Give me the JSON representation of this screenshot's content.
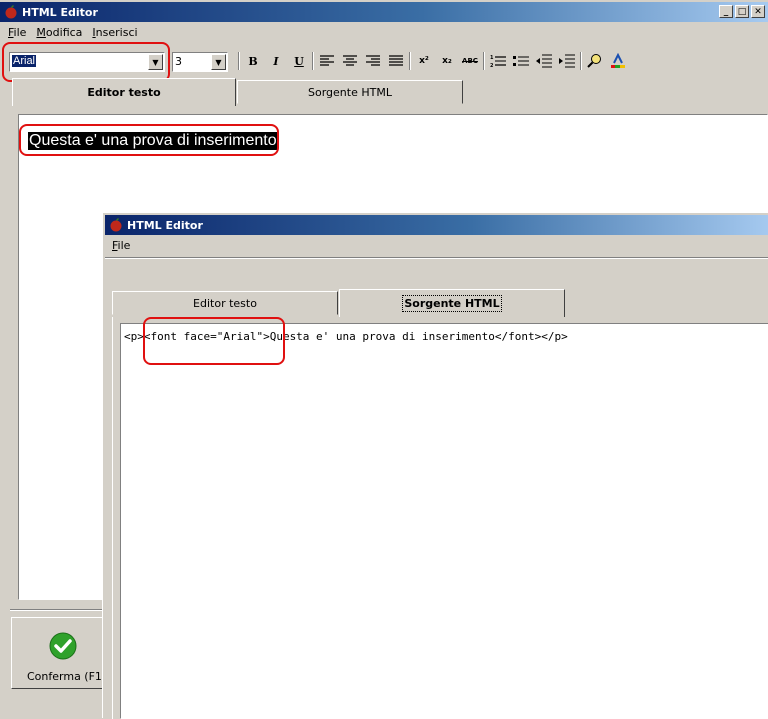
{
  "main_window": {
    "title": "HTML Editor",
    "menu": [
      "File",
      "Modifica",
      "Inserisci"
    ],
    "font_select_value": "Arial",
    "size_select_value": "3",
    "toolbar": {
      "bold": "B",
      "italic": "I",
      "underline": "U",
      "superscript": "x²",
      "subscript": "x₂",
      "spellcheck": "ABC"
    },
    "tabs": [
      "Editor testo",
      "Sorgente HTML"
    ],
    "active_tab": "Editor testo",
    "editor_text": "Questa e' una prova di inserimento",
    "confirm_label": "Conferma (F12)"
  },
  "second_window": {
    "title": "HTML Editor",
    "menu": [
      "File"
    ],
    "tabs": [
      "Editor testo",
      "Sorgente HTML"
    ],
    "active_tab": "Sorgente HTML",
    "source_text": "<p><font face=\"Arial\">Questa e' una prova di inserimento</font></p>"
  },
  "colors": {
    "title_gradient_start": "#0a246a",
    "title_gradient_end": "#a6caf0",
    "annotation_red": "#e01010",
    "confirm_green": "#2fa12b"
  }
}
